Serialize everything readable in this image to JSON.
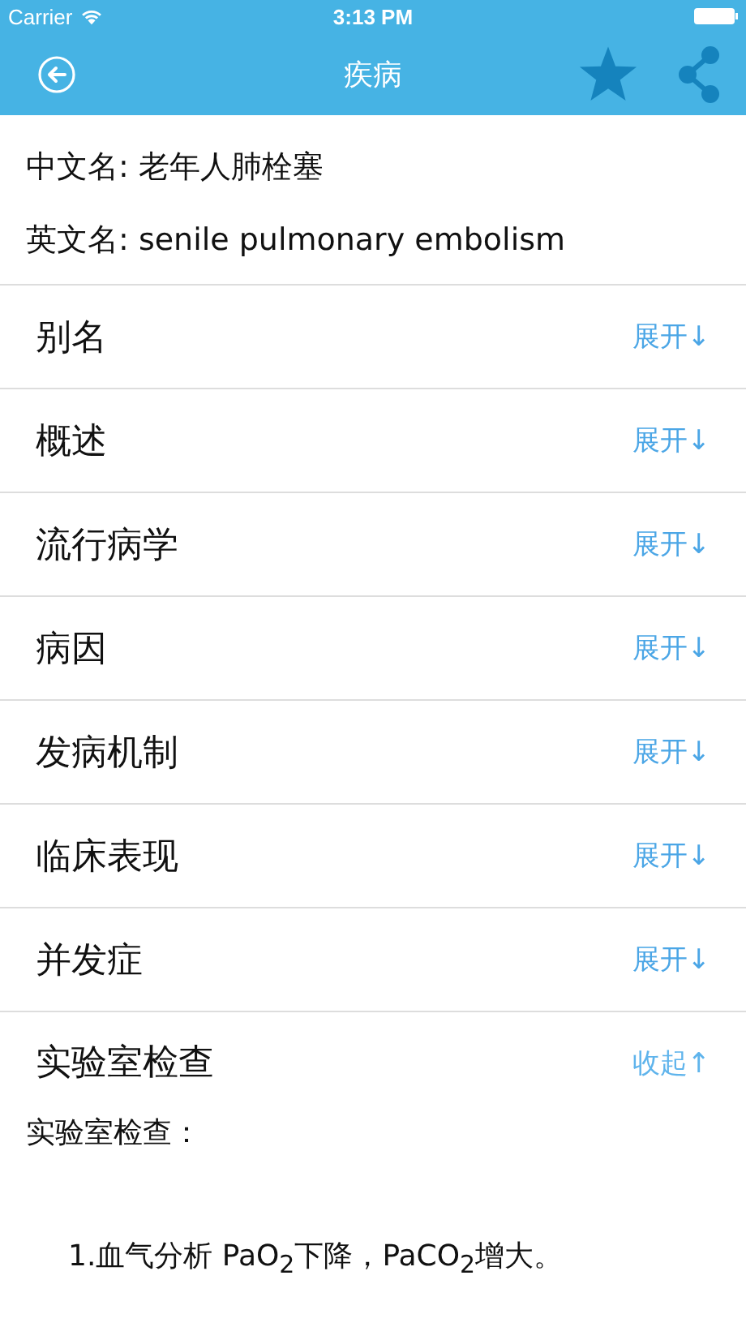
{
  "status_bar": {
    "carrier": "Carrier",
    "time": "3:13 PM"
  },
  "nav": {
    "title": "疾病"
  },
  "info": [
    {
      "label": "中文名:",
      "value": "老年人肺栓塞"
    },
    {
      "label": "英文名:",
      "value": "senile pulmonary embolism"
    }
  ],
  "sections": [
    {
      "title": "别名",
      "toggle": "展开↓",
      "expanded": false
    },
    {
      "title": "概述",
      "toggle": "展开↓",
      "expanded": false
    },
    {
      "title": "流行病学",
      "toggle": "展开↓",
      "expanded": false
    },
    {
      "title": "病因",
      "toggle": "展开↓",
      "expanded": false
    },
    {
      "title": "发病机制",
      "toggle": "展开↓",
      "expanded": false
    },
    {
      "title": "临床表现",
      "toggle": "展开↓",
      "expanded": false
    },
    {
      "title": "并发症",
      "toggle": "展开↓",
      "expanded": false
    },
    {
      "title": "实验室检查",
      "toggle": "收起↑",
      "expanded": true,
      "content": [
        "实验室检查：",
        "1.血气分析  PaO$_{2}$下降，PaCO$_{2}$增大。"
      ]
    }
  ]
}
